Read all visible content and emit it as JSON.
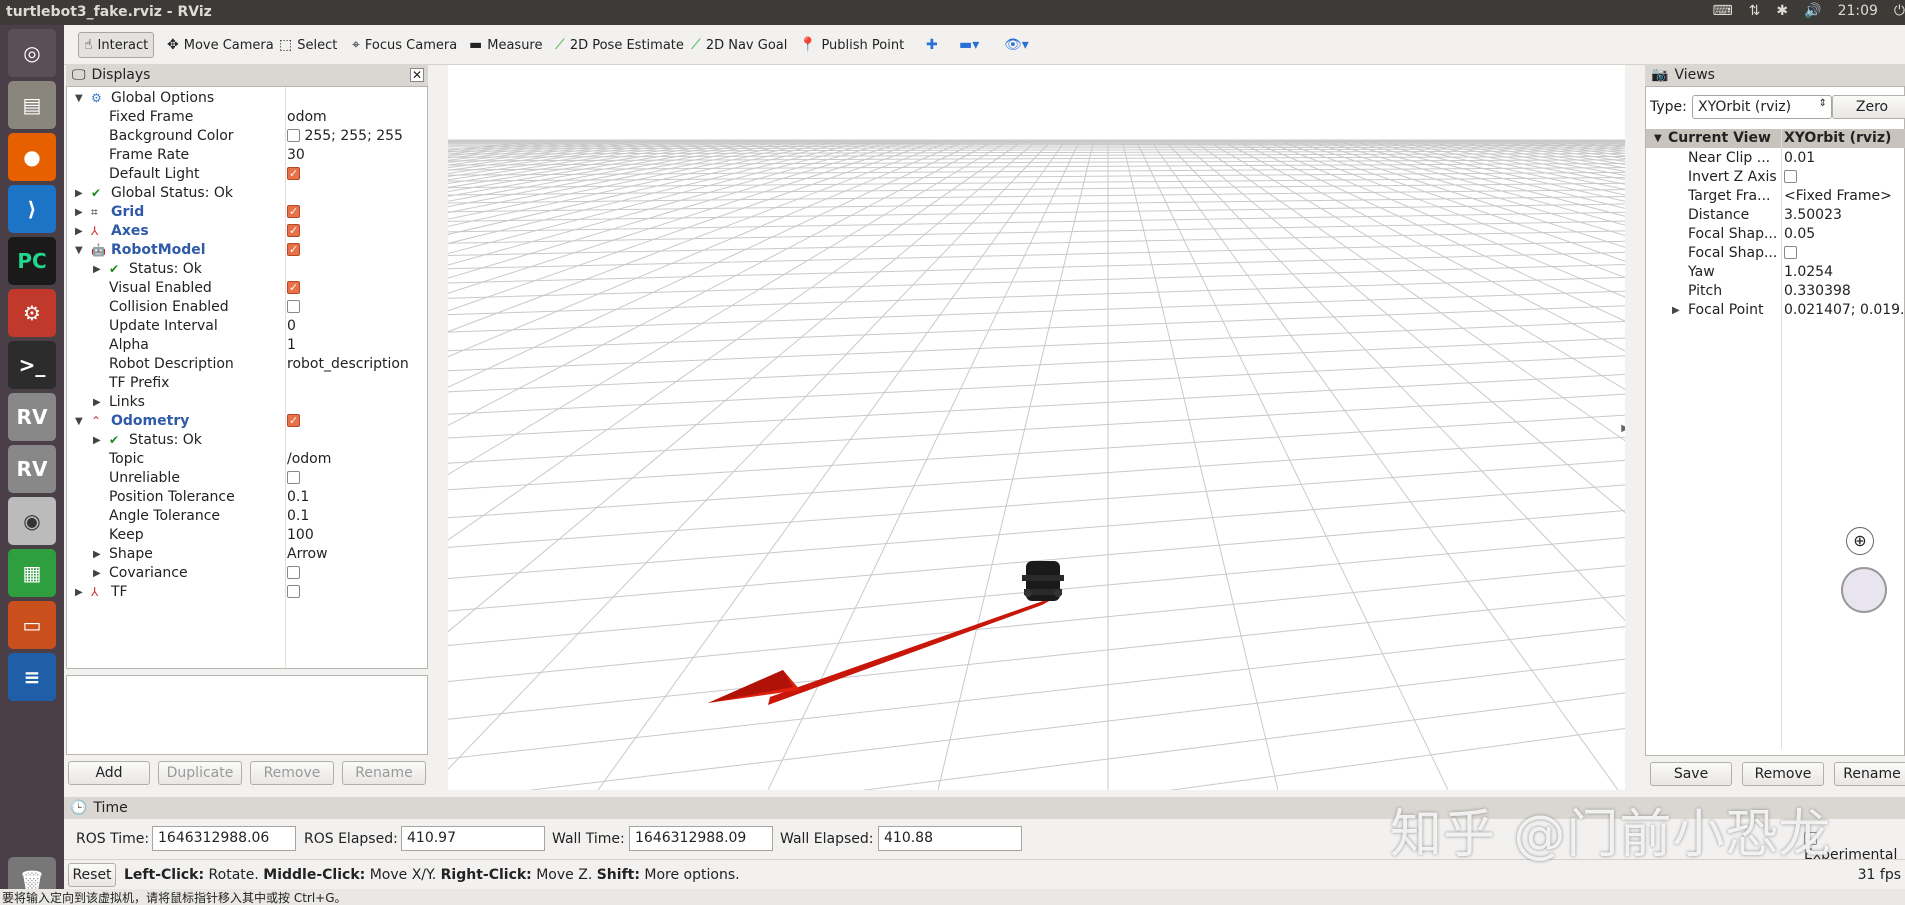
{
  "window_title": "turtlebot3_fake.rviz - RViz",
  "tray": {
    "keyboard": "⌨",
    "network": "⇅",
    "bluetooth": "✱",
    "volume": "🔊",
    "clock": "21:09",
    "power": "⏻"
  },
  "launcher_icons": [
    "ubuntu-icon",
    "files-icon",
    "firefox-icon",
    "vscode-icon",
    "pycharm-icon",
    "settings-icon",
    "terminal-icon",
    "rviz-icon",
    "rviz-icon",
    "dvd-icon",
    "spreadsheet-icon",
    "presentation-icon",
    "writer-icon",
    "trash-icon"
  ],
  "toolbar": {
    "interact": "Interact",
    "move_camera": "Move Camera",
    "select": "Select",
    "focus_camera": "Focus Camera",
    "measure": "Measure",
    "pose_estimate": "2D Pose Estimate",
    "nav_goal": "2D Nav Goal",
    "publish_point": "Publish Point"
  },
  "displays": {
    "title": "Displays",
    "rows": [
      {
        "name": "Global Options",
        "value": ""
      },
      {
        "name": "Fixed Frame",
        "value": "odom"
      },
      {
        "name": "Background Color",
        "value": "255; 255; 255"
      },
      {
        "name": "Frame Rate",
        "value": "30"
      },
      {
        "name": "Default Light",
        "value": ""
      },
      {
        "name": "Global Status: Ok",
        "value": ""
      },
      {
        "name": "Grid",
        "value": ""
      },
      {
        "name": "Axes",
        "value": ""
      },
      {
        "name": "RobotModel",
        "value": ""
      },
      {
        "name": "Status: Ok",
        "value": ""
      },
      {
        "name": "Visual Enabled",
        "value": ""
      },
      {
        "name": "Collision Enabled",
        "value": ""
      },
      {
        "name": "Update Interval",
        "value": "0"
      },
      {
        "name": "Alpha",
        "value": "1"
      },
      {
        "name": "Robot Description",
        "value": "robot_description"
      },
      {
        "name": "TF Prefix",
        "value": ""
      },
      {
        "name": "Links",
        "value": ""
      },
      {
        "name": "Odometry",
        "value": ""
      },
      {
        "name": "Status: Ok",
        "value": ""
      },
      {
        "name": "Topic",
        "value": "/odom"
      },
      {
        "name": "Unreliable",
        "value": ""
      },
      {
        "name": "Position Tolerance",
        "value": "0.1"
      },
      {
        "name": "Angle Tolerance",
        "value": "0.1"
      },
      {
        "name": "Keep",
        "value": "100"
      },
      {
        "name": "Shape",
        "value": "Arrow"
      },
      {
        "name": "Covariance",
        "value": ""
      },
      {
        "name": "TF",
        "value": ""
      }
    ],
    "buttons": {
      "add": "Add",
      "duplicate": "Duplicate",
      "remove": "Remove",
      "rename": "Rename"
    }
  },
  "views": {
    "title": "Views",
    "type_label": "Type:",
    "type_value": "XYOrbit (rviz)",
    "zero": "Zero",
    "header_name": "Current View",
    "header_value": "XYOrbit (rviz)",
    "rows": [
      {
        "name": "Near Clip ...",
        "value": "0.01"
      },
      {
        "name": "Invert Z Axis",
        "value": ""
      },
      {
        "name": "Target Fra...",
        "value": "<Fixed Frame>"
      },
      {
        "name": "Distance",
        "value": "3.50023"
      },
      {
        "name": "Focal Shap...",
        "value": "0.05"
      },
      {
        "name": "Focal Shap...",
        "value": ""
      },
      {
        "name": "Yaw",
        "value": "1.0254"
      },
      {
        "name": "Pitch",
        "value": "0.330398"
      },
      {
        "name": "Focal Point",
        "value": "0.021407; 0.019..."
      }
    ],
    "buttons": {
      "save": "Save",
      "remove": "Remove",
      "rename": "Rename"
    }
  },
  "time": {
    "title": "Time",
    "ros_time_label": "ROS Time:",
    "ros_time": "1646312988.06",
    "ros_elapsed_label": "ROS Elapsed:",
    "ros_elapsed": "410.97",
    "wall_time_label": "Wall Time:",
    "wall_time": "1646312988.09",
    "wall_elapsed_label": "Wall Elapsed:",
    "wall_elapsed": "410.88",
    "experimental": "Experimental"
  },
  "status": {
    "reset": "Reset",
    "left_click": "Left-Click:",
    "left_desc": " Rotate. ",
    "middle_click": "Middle-Click:",
    "middle_desc": " Move X/Y. ",
    "right_click": "Right-Click:",
    "right_desc": " Move Z. ",
    "shift": "Shift:",
    "shift_desc": " More options.",
    "fps": "31 fps"
  },
  "bottom_hint": "要将输入定向到该虚拟机，请将鼠标指针移入其中或按 Ctrl+G。",
  "watermark": "知乎 @门前小恐龙",
  "colors": {
    "accent_blue": "#2e5aa8",
    "checkbox_orange": "#e9714a",
    "odom_arrow_red": "#d01a0a",
    "launcher_bg": "#4a3f46",
    "titlebar_bg": "#3c3b37"
  }
}
